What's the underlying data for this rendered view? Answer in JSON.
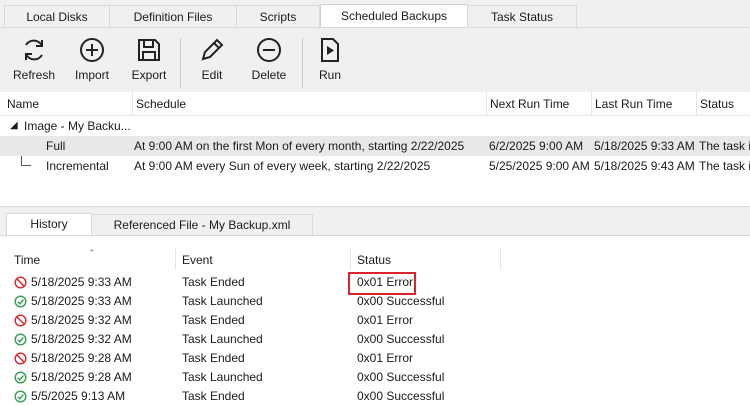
{
  "top_tabs": [
    {
      "label": "Local Disks"
    },
    {
      "label": "Definition Files"
    },
    {
      "label": "Scripts"
    },
    {
      "label": "Scheduled Backups",
      "active": true
    },
    {
      "label": "Task Status"
    }
  ],
  "toolbar": {
    "refresh_label": "Refresh",
    "import_label": "Import",
    "export_label": "Export",
    "edit_label": "Edit",
    "delete_label": "Delete",
    "run_label": "Run"
  },
  "schedule_list": {
    "columns": {
      "name": "Name",
      "schedule": "Schedule",
      "next_run": "Next Run Time",
      "last_run": "Last Run Time",
      "status": "Status"
    },
    "group_label": "Image - My Backu...",
    "rows": [
      {
        "name": "Full",
        "schedule": "At 9:00 AM on the first Mon of every month, starting 2/22/2025",
        "next_run": "6/2/2025 9:00 AM",
        "last_run": "5/18/2025 9:33 AM",
        "status": "The task is"
      },
      {
        "name": "Incremental",
        "schedule": "At 9:00 AM every Sun of every week, starting 2/22/2025",
        "next_run": "5/25/2025 9:00 AM",
        "last_run": "5/18/2025 9:43 AM",
        "status": "The task is"
      }
    ]
  },
  "bottom_tabs": [
    {
      "label": "History",
      "active": true
    },
    {
      "label": "Referenced File - My Backup.xml"
    }
  ],
  "history": {
    "columns": {
      "time": "Time",
      "event": "Event",
      "status": "Status"
    },
    "rows": [
      {
        "time": "5/18/2025 9:33 AM",
        "event": "Task Ended",
        "status": "0x01 Error",
        "icon": "error-icon"
      },
      {
        "time": "5/18/2025 9:33 AM",
        "event": "Task Launched",
        "status": "0x00 Successful",
        "icon": "success-icon"
      },
      {
        "time": "5/18/2025 9:32 AM",
        "event": "Task Ended",
        "status": "0x01 Error",
        "icon": "error-icon"
      },
      {
        "time": "5/18/2025 9:32 AM",
        "event": "Task Launched",
        "status": "0x00 Successful",
        "icon": "success-icon"
      },
      {
        "time": "5/18/2025 9:28 AM",
        "event": "Task Ended",
        "status": "0x01 Error",
        "icon": "error-icon"
      },
      {
        "time": "5/18/2025 9:28 AM",
        "event": "Task Launched",
        "status": "0x00 Successful",
        "icon": "success-icon"
      },
      {
        "time": "5/5/2025 9:13 AM",
        "event": "Task Ended",
        "status": "0x00 Successful",
        "icon": "success-icon"
      }
    ]
  },
  "colors": {
    "error": "#d9232d",
    "success": "#2e9e4f",
    "selected_row": "#e8e8e8"
  }
}
